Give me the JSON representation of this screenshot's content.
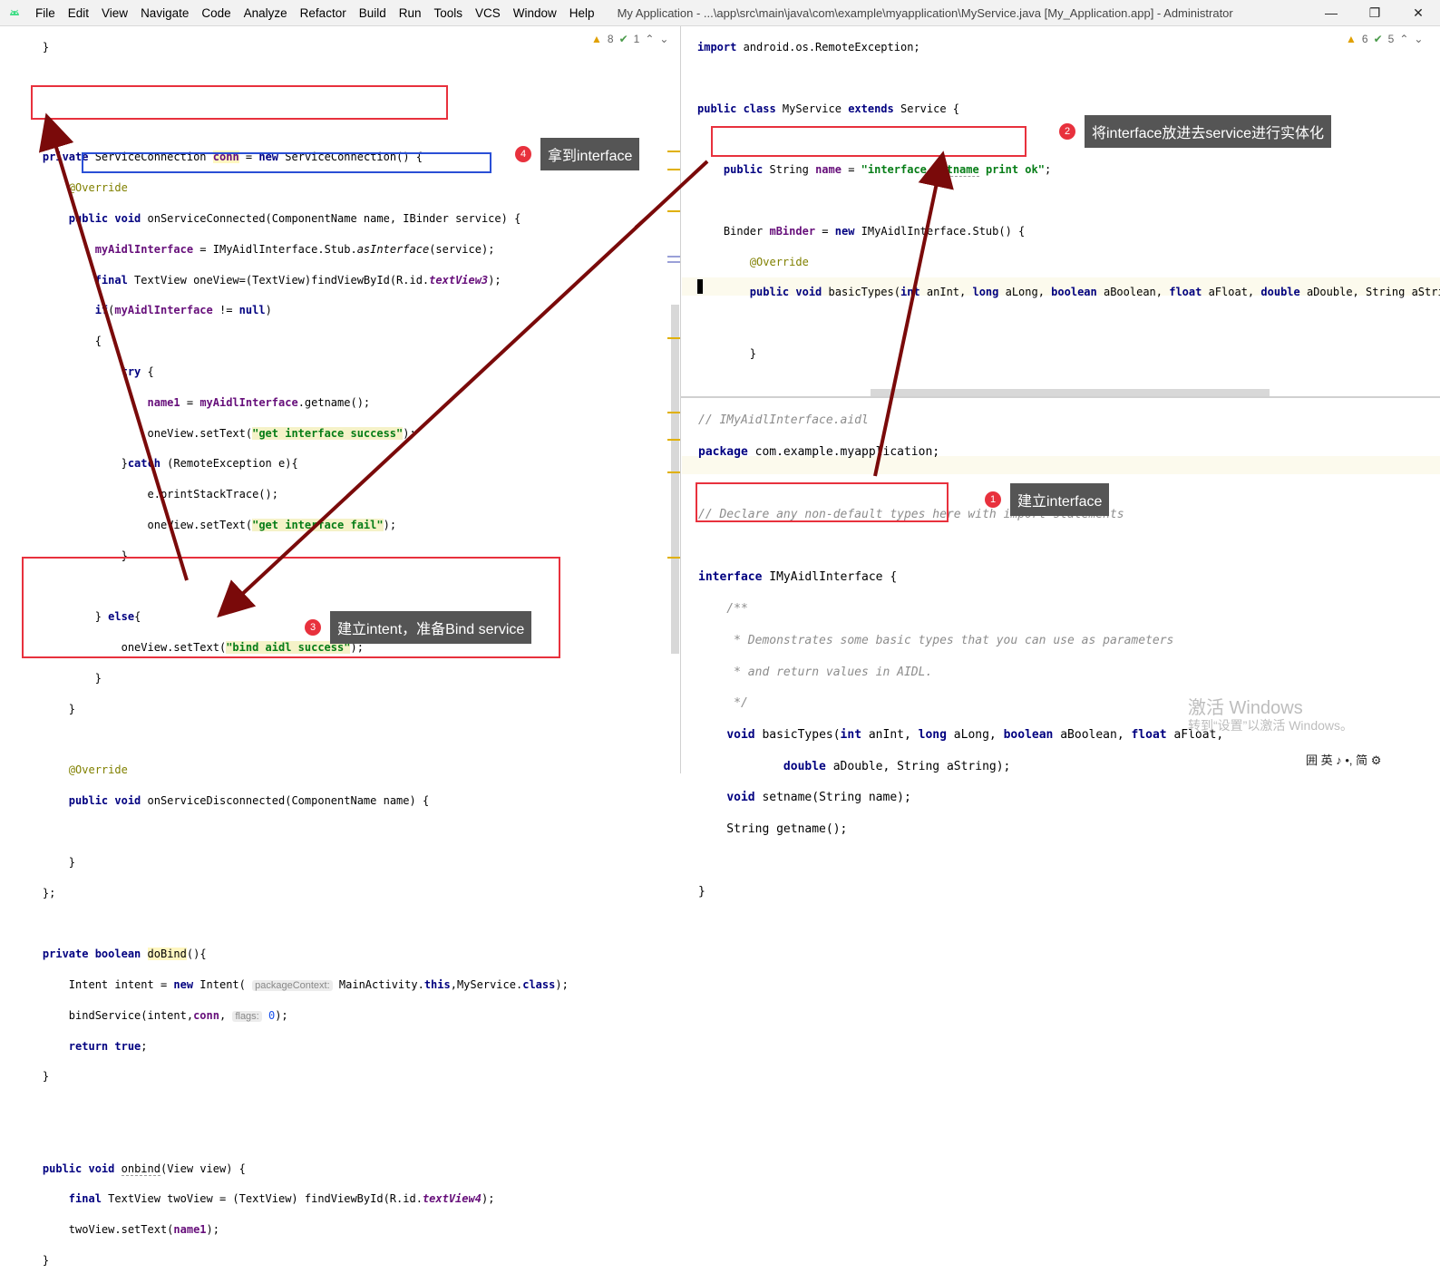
{
  "titlebar": {
    "menu": [
      "File",
      "Edit",
      "View",
      "Navigate",
      "Code",
      "Analyze",
      "Refactor",
      "Build",
      "Run",
      "Tools",
      "VCS",
      "Window",
      "Help"
    ],
    "title": "My Application - ...\\app\\src\\main\\java\\com\\example\\myapplication\\MyService.java [My_Application.app] - Administrator",
    "min": "—",
    "max": "❐",
    "close": "✕"
  },
  "left_inspection": {
    "warn": "8",
    "ok": "1"
  },
  "right_inspection": {
    "warn": "6",
    "ok": "5"
  },
  "callouts": [
    {
      "num": "4",
      "text": "拿到interface"
    },
    {
      "num": "2",
      "text": "将interface放进去service进行实体化"
    },
    {
      "num": "1",
      "text": "建立interface"
    },
    {
      "num": "3",
      "text": "建立intent，准备Bind service"
    }
  ],
  "watermark": {
    "line1": "激活 Windows",
    "line2": "转到“设置”以激活 Windows。"
  },
  "ime": "囲 英 ♪ •, 简 ⚙",
  "colors": {
    "annotation_red": "#e8313d",
    "annotation_blue": "#2a4fd6",
    "arrow": "#7a0a0a",
    "keyword": "#000080"
  }
}
